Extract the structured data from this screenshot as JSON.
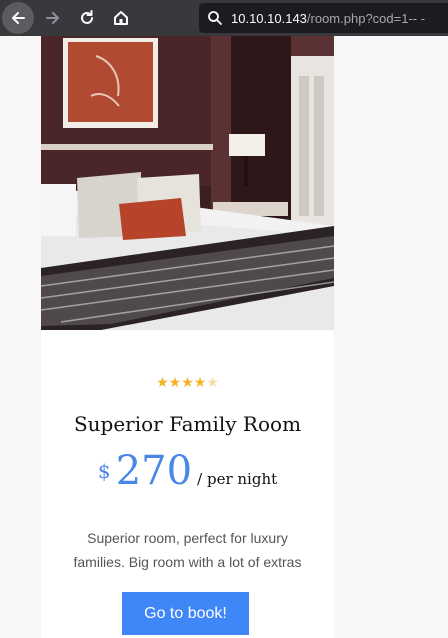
{
  "browser": {
    "url_host": "10.10.10.143",
    "url_path": "/room.php?cod=1-- -"
  },
  "room": {
    "rating": 4.5,
    "rating_max": 5,
    "stars": [
      "★",
      "★",
      "★",
      "★",
      "★"
    ],
    "title": "Superior Family Room",
    "currency": "$",
    "price": "270",
    "per_night": "/ per night",
    "description": "Superior room, perfect for luxury families. Big room with a lot of extras",
    "book_label": "Go to book!"
  },
  "colors": {
    "accent": "#4a86e8",
    "button": "#3f86f7",
    "star": "#f5b323"
  }
}
